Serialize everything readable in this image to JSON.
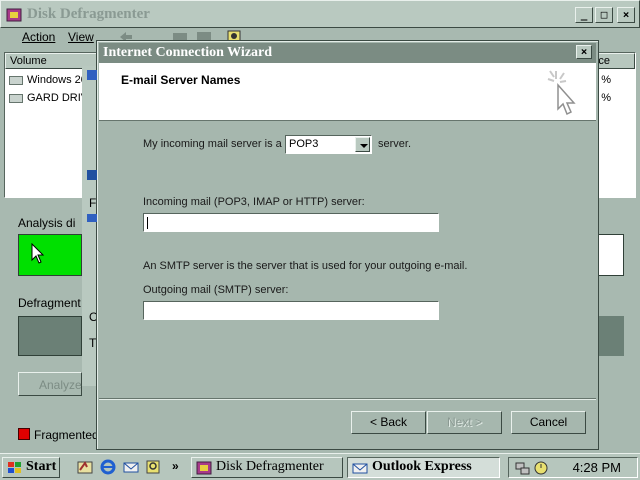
{
  "background_window": {
    "title": "Disk Defragmenter",
    "menu": [
      "Action",
      "View"
    ],
    "list_header": "Volume",
    "list_header_right": "ce",
    "volumes": [
      {
        "name": "Windows 20",
        "pct": "%"
      },
      {
        "name": "GARD DRIV",
        "pct": "%"
      }
    ],
    "analysis_label": "Analysis di",
    "defrag_label": "Defragment",
    "analyze_button": "Analyze",
    "legend_fragmented": "Fragmented",
    "caption_buttons": {
      "minimize": "_",
      "maximize": "□",
      "close": "×"
    }
  },
  "middle_window": {
    "labels": [
      "F",
      "O",
      "T"
    ]
  },
  "wizard": {
    "title": "Internet Connection Wizard",
    "close_glyph": "×",
    "page_title": "E-mail Server Names",
    "incoming_prefix": "My incoming mail server is a",
    "server_type": "POP3",
    "incoming_suffix": "server.",
    "incoming_label": "Incoming mail (POP3, IMAP or HTTP) server:",
    "incoming_value": "",
    "smtp_note": "An SMTP server is the server that is used for your outgoing e-mail.",
    "outgoing_label": "Outgoing mail (SMTP) server:",
    "outgoing_value": "",
    "buttons": {
      "back": "< Back",
      "next": "Next >",
      "cancel": "Cancel"
    }
  },
  "taskbar": {
    "start_label": "Start",
    "more_glyph": "»",
    "tasks": [
      {
        "label": "Disk Defragmenter",
        "active": false
      },
      {
        "label": "Outlook Express",
        "active": true
      }
    ],
    "clock": "4:28 PM"
  },
  "colors": {
    "desktop_accent": "#9fb2a8",
    "wizard_title_bg": "#7b8c83",
    "analysis_green": "#00e000",
    "fragmented_red": "#e00000"
  }
}
